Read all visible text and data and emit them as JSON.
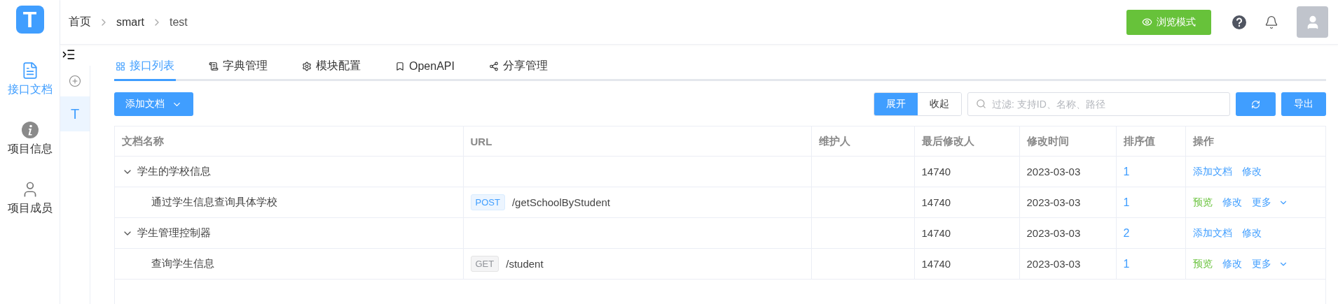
{
  "app": {
    "logo": "T"
  },
  "nav": [
    {
      "label": "接口文档",
      "kind": "document",
      "selected": true
    },
    {
      "label": "项目信息",
      "kind": "info",
      "selected": false
    },
    {
      "label": "项目成员",
      "kind": "user",
      "selected": false
    }
  ],
  "breadcrumb": [
    "首页",
    "smart",
    "test"
  ],
  "header": {
    "preview_button": "浏览模式"
  },
  "project_rail": {
    "items": [
      {
        "kind": "add",
        "selected": false
      },
      {
        "kind": "project",
        "label": "T",
        "selected": true
      }
    ]
  },
  "tabs": [
    {
      "label": "接口列表",
      "kind": "grid",
      "selected": true
    },
    {
      "label": "字典管理",
      "kind": "dictionary",
      "selected": false
    },
    {
      "label": "模块配置",
      "kind": "gear",
      "selected": false
    },
    {
      "label": "OpenAPI",
      "kind": "bookmark",
      "selected": false
    },
    {
      "label": "分享管理",
      "kind": "share",
      "selected": false
    }
  ],
  "toolbar": {
    "add_button": "添加文档",
    "toggle": [
      {
        "label": "展开",
        "selected": true
      },
      {
        "label": "收起",
        "selected": false
      }
    ],
    "search": {
      "placeholder": "过滤: 支持ID、名称、路径"
    },
    "export_button": "导出"
  },
  "table": {
    "columns": [
      "文档名称",
      "URL",
      "维护人",
      "最后修改人",
      "修改时间",
      "排序值",
      "操作"
    ],
    "rows": [
      {
        "kind": "group",
        "expanded": true,
        "name": "学生的学校信息",
        "modifier": "14740",
        "modified": "2023-03-03",
        "order": "1",
        "actions": [
          {
            "label": "添加文档",
            "kind": "link"
          },
          {
            "label": "修改",
            "kind": "link"
          }
        ]
      },
      {
        "kind": "doc",
        "name": "通过学生信息查询具体学校",
        "method": {
          "label": "POST",
          "kind": "post"
        },
        "url": "/getSchoolByStudent",
        "modifier": "14740",
        "modified": "2023-03-03",
        "order": "1",
        "actions": [
          {
            "label": "预览",
            "kind": "preview"
          },
          {
            "label": "修改",
            "kind": "link"
          },
          {
            "label": "更多",
            "kind": "dropdown"
          }
        ]
      },
      {
        "kind": "group",
        "expanded": true,
        "name": "学生管理控制器",
        "modifier": "14740",
        "modified": "2023-03-03",
        "order": "2",
        "actions": [
          {
            "label": "添加文档",
            "kind": "link"
          },
          {
            "label": "修改",
            "kind": "link"
          }
        ]
      },
      {
        "kind": "doc",
        "name": "查询学生信息",
        "method": {
          "label": "GET",
          "kind": "get"
        },
        "url": "/student",
        "modifier": "14740",
        "modified": "2023-03-03",
        "order": "1",
        "actions": [
          {
            "label": "预览",
            "kind": "preview"
          },
          {
            "label": "修改",
            "kind": "link"
          },
          {
            "label": "更多",
            "kind": "dropdown"
          }
        ]
      }
    ]
  }
}
